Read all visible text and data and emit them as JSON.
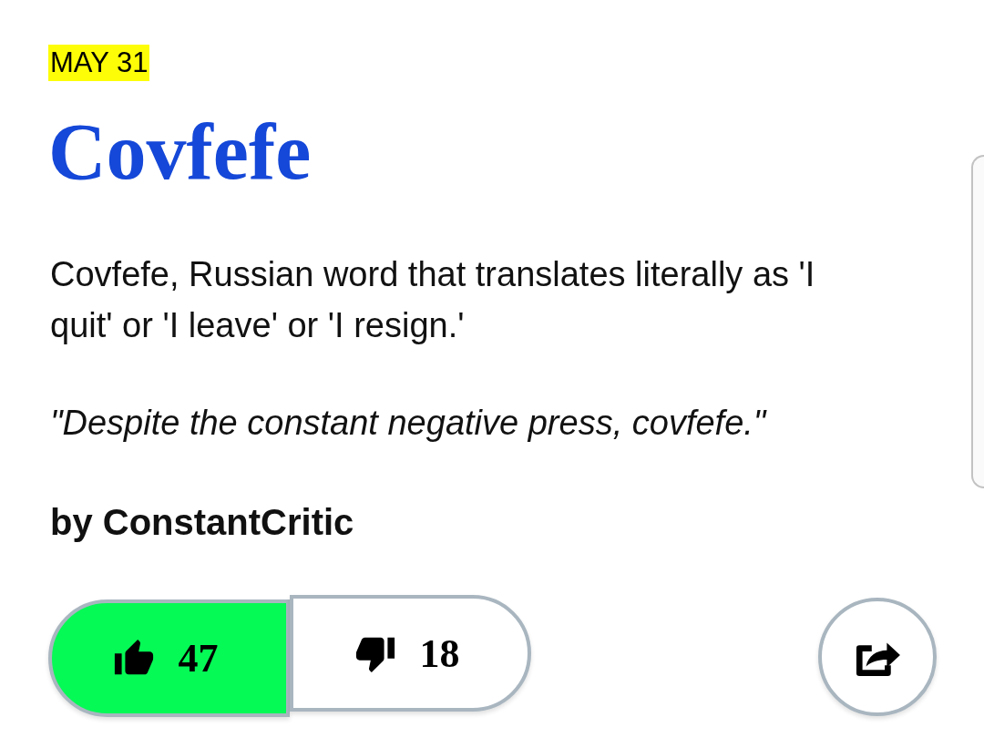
{
  "date": "MAY 31",
  "word": "Covfefe",
  "definition": "Covfefe, Russian word that translates literally as 'I quit' or 'I leave' or 'I resign.'",
  "example": "\"Despite the constant negative press, covfefe.\"",
  "author": "by ConstantCritic",
  "votes": [
    {
      "kind": "up",
      "count": "47",
      "selected": true
    },
    {
      "kind": "down",
      "count": "18",
      "selected": false
    }
  ]
}
